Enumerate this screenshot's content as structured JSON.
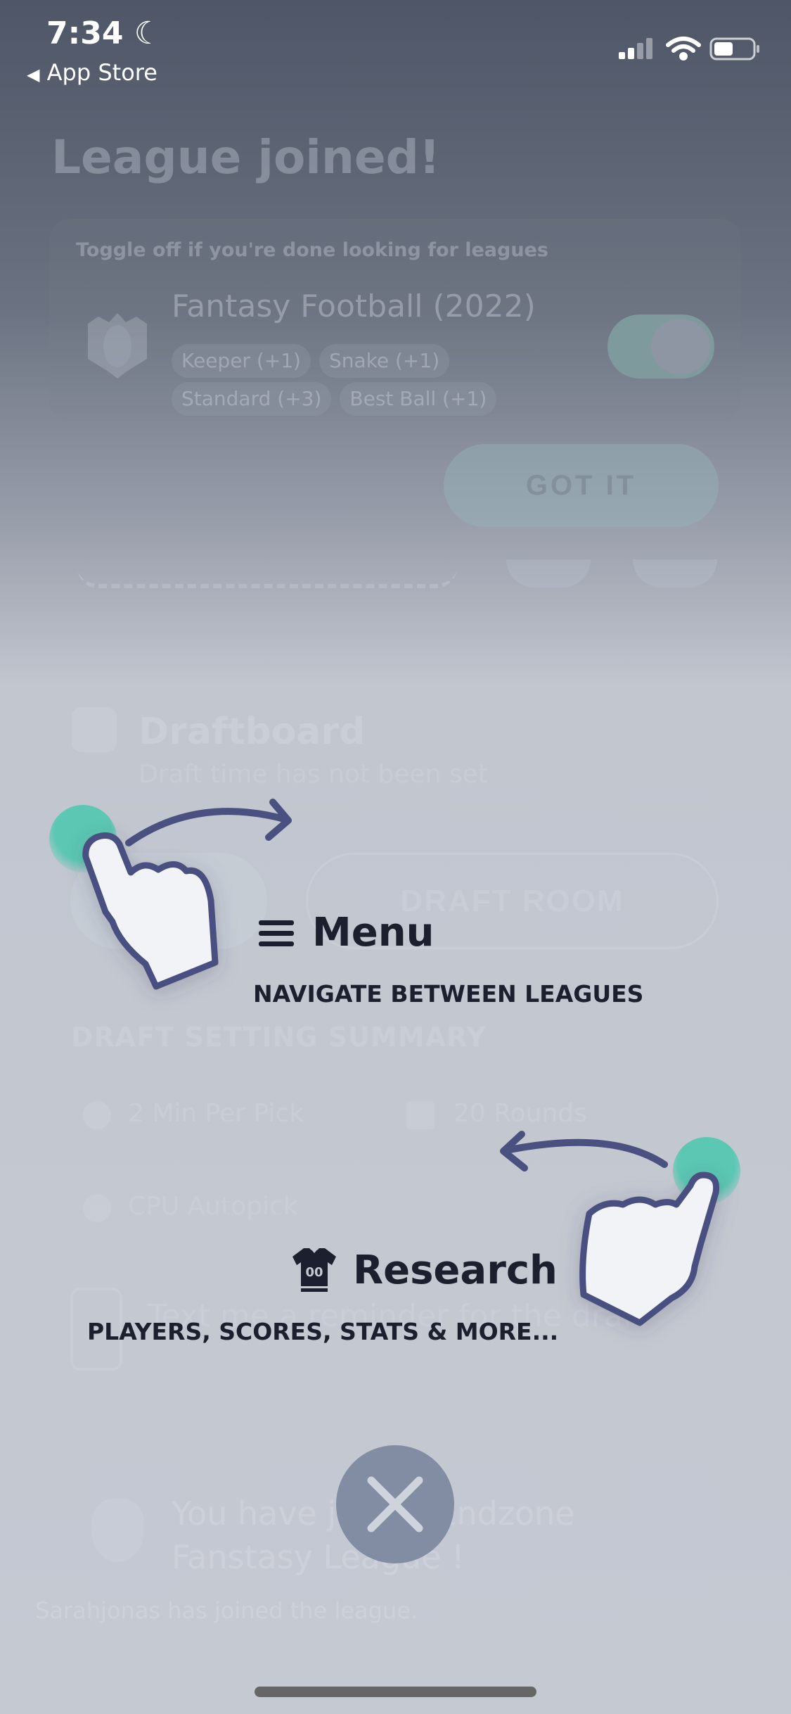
{
  "status_bar": {
    "time": "7:34",
    "back_label": "App Store"
  },
  "background": {
    "title": "League joined!",
    "card": {
      "hint": "Toggle off if you're done looking for leagues",
      "league_name": "Fantasy Football (2022)",
      "chips": [
        "Keeper (+1)",
        "Snake (+1)",
        "Standard (+3)",
        "Best Ball (+1)"
      ],
      "toggle_on": true
    },
    "got_it_label": "GOT IT",
    "draftboard": {
      "title": "Draftboard",
      "subtitle": "Draft time has not been set"
    },
    "draft_room_label": "DRAFT ROOM",
    "summary_title": "DRAFT SETTING SUMMARY",
    "settings": [
      "2 Min Per Pick",
      "20 Rounds",
      "CPU Autopick"
    ],
    "reminder": "Text me a reminder for the draft",
    "notification": {
      "message": "You have joined Endzone Fanstasy League !",
      "detail": "Sarahjonas has joined the league."
    }
  },
  "tips": {
    "menu": {
      "icon": "hamburger-icon",
      "title": "Menu",
      "subtitle": "NAVIGATE BETWEEN LEAGUES"
    },
    "research": {
      "icon": "jersey-icon",
      "jersey_number": "00",
      "title": "Research",
      "subtitle": "PLAYERS, SCORES, STATS & MORE..."
    }
  },
  "colors": {
    "tap_accent": "#5cc8b4",
    "hand_outline": "#4a5080",
    "close_button": "#828da3",
    "tip_text": "#1b1f2e"
  }
}
